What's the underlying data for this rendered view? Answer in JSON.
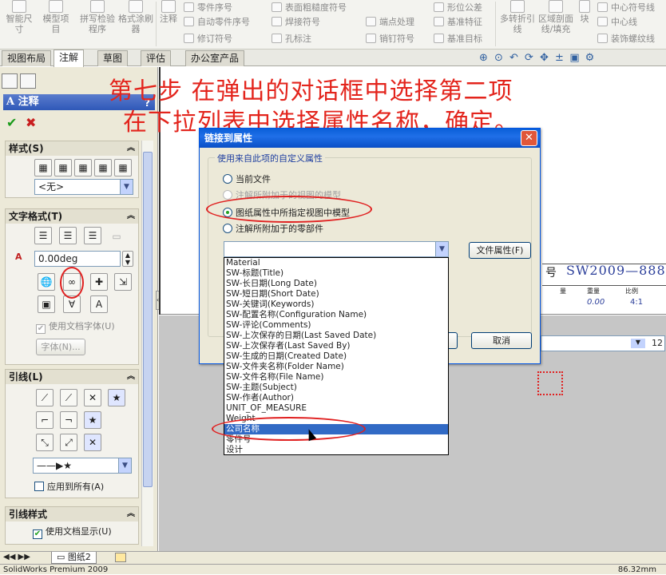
{
  "ribbon": {
    "big_buttons": [
      {
        "label": "智能尺寸",
        "icon": "smart-dimension-icon"
      },
      {
        "label": "模型项目",
        "icon": "model-items-icon"
      },
      {
        "label": "拼写检验程序",
        "icon": "spell-check-icon"
      },
      {
        "label": "格式涂刷器",
        "icon": "format-painter-icon"
      },
      {
        "label": "注释",
        "icon": "note-icon"
      },
      {
        "label": "多转折引线",
        "icon": "multi-jog-leader-icon"
      },
      {
        "label": "区域剖面线/填充",
        "icon": "area-hatch-icon"
      },
      {
        "label": "块",
        "icon": "block-icon"
      }
    ],
    "small_buttons": [
      {
        "label": "零件序号",
        "icon": "balloon-icon"
      },
      {
        "label": "自动零件序号",
        "icon": "auto-balloon-icon"
      },
      {
        "label": "修订符号",
        "icon": "revision-symbol-icon"
      },
      {
        "label": "表面粗糙度符号",
        "icon": "surface-finish-icon"
      },
      {
        "label": "焊接符号",
        "icon": "weld-symbol-icon"
      },
      {
        "label": "孔标注",
        "icon": "hole-callout-icon"
      },
      {
        "label": "端点处理",
        "icon": "end-treatment-icon"
      },
      {
        "label": "销钉符号",
        "icon": "dowel-pin-icon"
      },
      {
        "label": "形位公差",
        "icon": "geometric-tolerance-icon"
      },
      {
        "label": "基准特征",
        "icon": "datum-feature-icon"
      },
      {
        "label": "基准目标",
        "icon": "datum-target-icon"
      },
      {
        "label": "中心符号线",
        "icon": "center-mark-icon"
      },
      {
        "label": "中心线",
        "icon": "centerline-icon"
      },
      {
        "label": "装饰螺纹线",
        "icon": "cosmetic-thread-icon"
      }
    ]
  },
  "tabs": [
    {
      "label": "视图布局",
      "active": false
    },
    {
      "label": "注解",
      "active": true
    },
    {
      "label": "草图",
      "active": false
    },
    {
      "label": "评估",
      "active": false
    },
    {
      "label": "办公室产品",
      "active": false
    }
  ],
  "property_manager": {
    "title": "注释",
    "help": "?",
    "style_group": {
      "title": "样式(S)",
      "style_value": "<无>"
    },
    "text_format_group": {
      "title": "文字格式(T)",
      "angle_value": "0.00deg",
      "use_doc_font_label": "使用文档字体(U)",
      "font_button": "字体(N)..."
    },
    "leader_group": {
      "title": "引线(L)",
      "apply_all_label": "应用到所有(A)"
    },
    "leader_style_group": {
      "title": "引线样式",
      "use_doc_display_label": "使用文档显示(U)"
    }
  },
  "instruction": {
    "line1": "第七步    在弹出的对话框中选择第二项",
    "line2": "在下拉列表中选择属性名称，确定。"
  },
  "dialog": {
    "title": "链接到属性",
    "group_label": "使用来自此项的自定义属性",
    "options": [
      {
        "label": "当前文件",
        "selected": false,
        "disabled": false
      },
      {
        "label": "注解所附加于的视图的模型",
        "selected": false,
        "disabled": true
      },
      {
        "label": "图纸属性中所指定视图中模型",
        "selected": true,
        "disabled": false
      },
      {
        "label": "注解所附加于的零部件",
        "selected": false,
        "disabled": false
      }
    ],
    "file_properties_button": "文件属性(F)",
    "cancel_button": "取消",
    "dropdown_items": [
      "Material",
      "SW-标题(Title)",
      "SW-长日期(Long Date)",
      "SW-短日期(Short Date)",
      "SW-关键词(Keywords)",
      "SW-配置名称(Configuration Name)",
      "SW-评论(Comments)",
      "SW-上次保存的日期(Last Saved Date)",
      "SW-上次保存者(Last Saved By)",
      "SW-生成的日期(Created Date)",
      "SW-文件夹名称(Folder Name)",
      "SW-文件名称(File Name)",
      "SW-主题(Subject)",
      "SW-作者(Author)",
      "UNIT_OF_MEASURE",
      "Weight",
      "公司名称",
      "零件号",
      "设计"
    ],
    "selected_item": "公司名称"
  },
  "drawing": {
    "title_block_label": "号",
    "part_number": "SW2009—888",
    "col_headers": [
      "量",
      "重量",
      "比例"
    ],
    "values": [
      "0.00",
      "4:1"
    ],
    "font_size_value": "12"
  },
  "sheet_tab": "图纸2",
  "status": {
    "app": "SolidWorks Premium 2009",
    "measure": "86.32mm"
  }
}
